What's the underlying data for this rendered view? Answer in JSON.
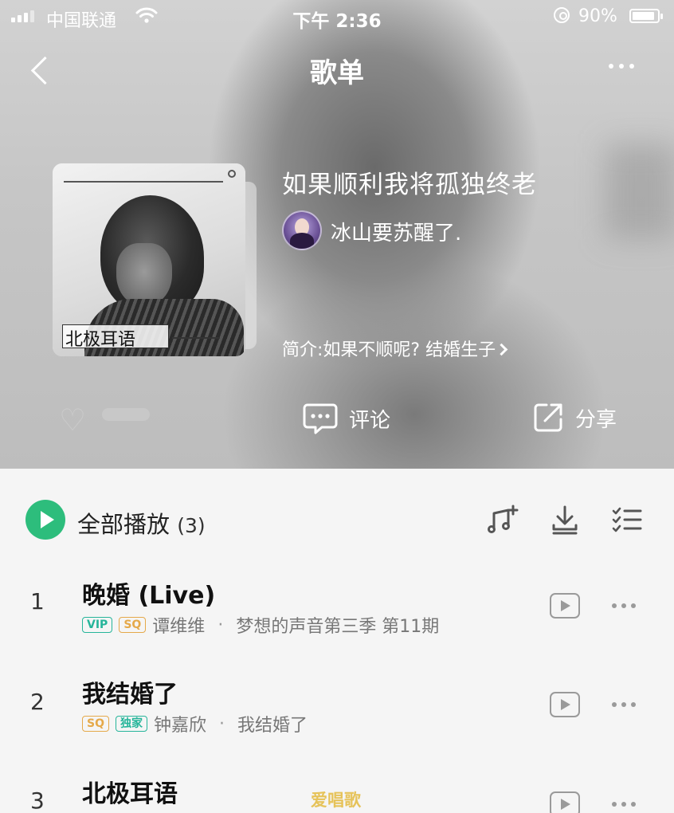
{
  "status_bar": {
    "carrier": "中国联通",
    "time": "下午 2:36",
    "battery": "90%",
    "battery_level": 0.9
  },
  "nav": {
    "title": "歌单",
    "back_icon": "chevron-left-icon",
    "more_icon": "more-dots-icon"
  },
  "playlist": {
    "title": "如果顺利我将孤独终老",
    "creator": "冰山要苏醒了.",
    "intro": "简介:如果不顺呢? 结婚生子",
    "cover_title": "北极耳语"
  },
  "actions": {
    "comment_label": "评论",
    "share_label": "分享"
  },
  "list_header": {
    "play_all_label": "全部播放",
    "count": "(3)"
  },
  "songs": [
    {
      "index": "1",
      "name": "晚婚 (Live)",
      "badges": [
        "VIP",
        "SQ"
      ],
      "artist": "谭维维",
      "album": "梦想的声音第三季 第11期"
    },
    {
      "index": "2",
      "name": "我结婚了",
      "badges": [
        "SQ",
        "独家"
      ],
      "artist": "钟嘉欣",
      "album": "我结婚了"
    },
    {
      "index": "3",
      "name": "北极耳语"
    }
  ],
  "watermark": "爱唱歌",
  "colors": {
    "accent_green": "#2dbd7c",
    "vip_badge": "#26b59a",
    "sq_badge": "#e5a94a"
  }
}
